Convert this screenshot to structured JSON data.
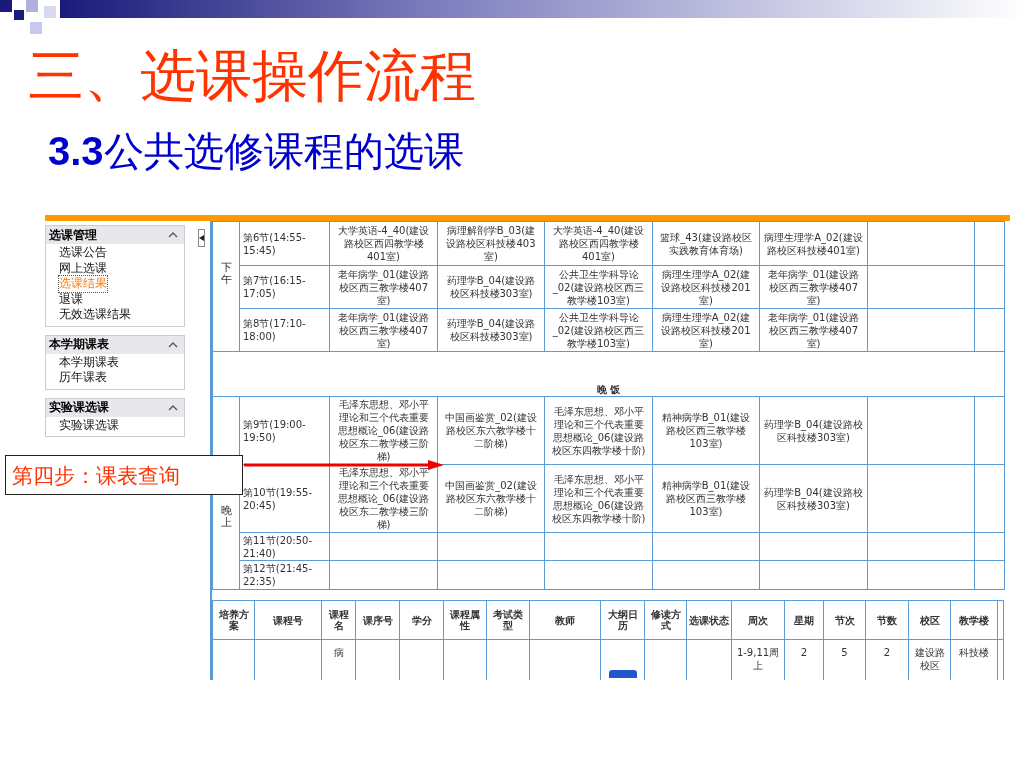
{
  "slide": {
    "title": "三、选课操作流程",
    "subtitle_number": "3.3",
    "subtitle": "公共选修课程的选课",
    "callout": "第四步：课表查询"
  },
  "sidebar": [
    {
      "title": "选课管理",
      "expanded": true,
      "items": [
        {
          "label": "选课公告",
          "selected": false
        },
        {
          "label": "网上选课",
          "selected": false
        },
        {
          "label": "选课结果",
          "selected": true
        },
        {
          "label": "退课",
          "selected": false
        },
        {
          "label": "无效选课结果",
          "selected": false
        }
      ]
    },
    {
      "title": "本学期课表",
      "expanded": true,
      "items": [
        {
          "label": "本学期课表",
          "selected": false
        },
        {
          "label": "历年课表",
          "selected": false
        }
      ]
    },
    {
      "title": "实验课选课",
      "expanded": true,
      "items": [
        {
          "label": "实验课选课",
          "selected": false
        }
      ]
    }
  ],
  "timetable": {
    "sessions": [
      {
        "kind": "session",
        "label": "下午",
        "periods": [
          {
            "period": "第6节(14:55-15:45)",
            "courses": [
              "大学英语-4_40(建设路校区西四教学楼401室)",
              "病理解剖学B_03(建设路校区科技楼403室)",
              "大学英语-4_40(建设路校区西四教学楼401室)",
              "篮球_43(建设路校区实践教育体育场)",
              "病理生理学A_02(建设路校区科技楼401室)"
            ]
          },
          {
            "period": "第7节(16:15-17:05)",
            "courses": [
              "老年病学_01(建设路校区西三教学楼407室)",
              "药理学B_04(建设路校区科技楼303室)",
              "公共卫生学科导论_02(建设路校区西三教学楼103室)",
              "病理生理学A_02(建设路校区科技楼201室)",
              "老年病学_01(建设路校区西三教学楼407室)"
            ]
          },
          {
            "period": "第8节(17:10-18:00)",
            "courses": [
              "老年病学_01(建设路校区西三教学楼407室)",
              "药理学B_04(建设路校区科技楼303室)",
              "公共卫生学科导论_02(建设路校区西三教学楼103室)",
              "病理生理学A_02(建设路校区科技楼201室)",
              "老年病学_01(建设路校区西三教学楼407室)"
            ]
          }
        ]
      },
      {
        "kind": "break",
        "label": "晚 饭"
      },
      {
        "kind": "session",
        "label": "晚上",
        "periods": [
          {
            "period": "第9节(19:00-19:50)",
            "courses": [
              "毛泽东思想、邓小平理论和三个代表重要思想概论_06(建设路校区东二教学楼三阶梯)",
              "中国画鉴赏_02(建设路校区东六教学楼十二阶梯)",
              "毛泽东思想、邓小平理论和三个代表重要思想概论_06(建设路校区东四教学楼十阶)",
              "精神病学B_01(建设路校区西三教学楼103室)",
              "药理学B_04(建设路校区科技楼303室)"
            ]
          },
          {
            "period": "第10节(19:55-20:45)",
            "courses": [
              "毛泽东思想、邓小平理论和三个代表重要思想概论_06(建设路校区东二教学楼三阶梯)",
              "中国画鉴赏_02(建设路校区东六教学楼十二阶梯)",
              "毛泽东思想、邓小平理论和三个代表重要思想概论_06(建设路校区东四教学楼十阶)",
              "精神病学B_01(建设路校区西三教学楼103室)",
              "药理学B_04(建设路校区科技楼303室)"
            ]
          },
          {
            "period": "第11节(20:50-21:40)"
          },
          {
            "period": "第12节(21:45-22:35)"
          }
        ]
      }
    ]
  },
  "course_table": {
    "columns": [
      "培养方案",
      "课程号",
      "课程名",
      "课序号",
      "学分",
      "课程属性",
      "考试类型",
      "教师",
      "大纲日历",
      "修读方式",
      "选课状态",
      "周次",
      "星期",
      "节次",
      "节数",
      "校区",
      "教学楼"
    ],
    "rows": [
      {
        "course_name": "病",
        "weeks": "1-9,11周上",
        "weekday": "2",
        "period": "5",
        "period_count": "2",
        "campus": "建设路校区",
        "building": "科技楼"
      }
    ]
  }
}
